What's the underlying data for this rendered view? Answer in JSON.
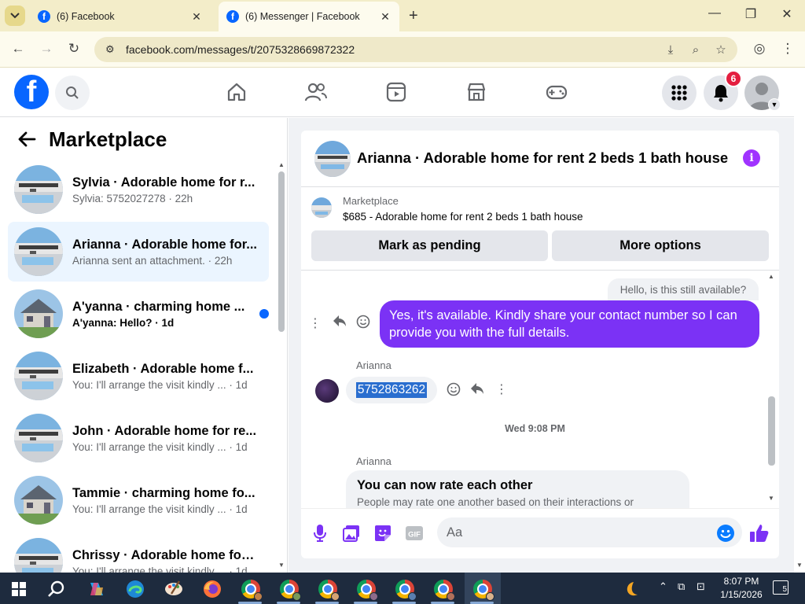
{
  "browser": {
    "tabs": [
      {
        "title": "(6) Facebook",
        "active": false
      },
      {
        "title": "(6) Messenger | Facebook",
        "active": true
      }
    ],
    "new_tab_symbol": "+",
    "url": "facebook.com/messages/t/2075328669872322"
  },
  "fb_nav": {
    "logo_letter": "f",
    "notification_count": "6"
  },
  "sidebar": {
    "title": "Marketplace",
    "conversations": [
      {
        "name": "Sylvia · Adorable home for r...",
        "preview": "Sylvia: 5752027278 · 22h",
        "thumb": "pool",
        "active": false,
        "unread": false
      },
      {
        "name": "Arianna · Adorable home for...",
        "preview": "Arianna sent an attachment. · 22h",
        "thumb": "pool",
        "active": true,
        "unread": false
      },
      {
        "name": "A'yanna · charming home ...",
        "preview": "A'yanna: Hello? · 1d",
        "thumb": "house",
        "active": false,
        "unread": true
      },
      {
        "name": "Elizabeth · Adorable home f...",
        "preview": "You: I'll arrange the visit kindly ... · 1d",
        "thumb": "pool",
        "active": false,
        "unread": false
      },
      {
        "name": "John · Adorable home for re...",
        "preview": "You: I'll arrange the visit kindly ... · 1d",
        "thumb": "pool",
        "active": false,
        "unread": false
      },
      {
        "name": "Tammie · charming home fo...",
        "preview": "You: I'll arrange the visit kindly ... · 1d",
        "thumb": "house",
        "active": false,
        "unread": false
      },
      {
        "name": "Chrissy · Adorable home for ...",
        "preview": "You: I'll arrange the visit kindly ... · 1d",
        "thumb": "pool",
        "active": false,
        "unread": false
      }
    ]
  },
  "chat": {
    "title": "Arianna · Adorable home for rent 2 beds 1 bath house",
    "listing_source": "Marketplace",
    "listing_desc": "$685 - Adorable home for rent 2 beds 1 bath house",
    "btn_pending": "Mark as pending",
    "btn_more": "More options",
    "msg_prev": "Hello, is this still available?",
    "msg_me": "Yes, it's available. Kindly share your contact number so I can provide you with the full details.",
    "sender_1": "Arianna",
    "msg_number": "5752863262",
    "timestamp": "Wed 9:08 PM",
    "sender_2": "Arianna",
    "rate_title": "You can now rate each other",
    "rate_body": "People may rate one another based on their interactions or",
    "composer_placeholder": "Aa",
    "colors": {
      "accent": "#7b32f5",
      "fb_blue": "#0866ff",
      "badge": "#e41e3f",
      "info": "#a033ff"
    }
  },
  "taskbar": {
    "time": "8:07 PM",
    "date": "1/15/2026",
    "notification_count": "5"
  }
}
